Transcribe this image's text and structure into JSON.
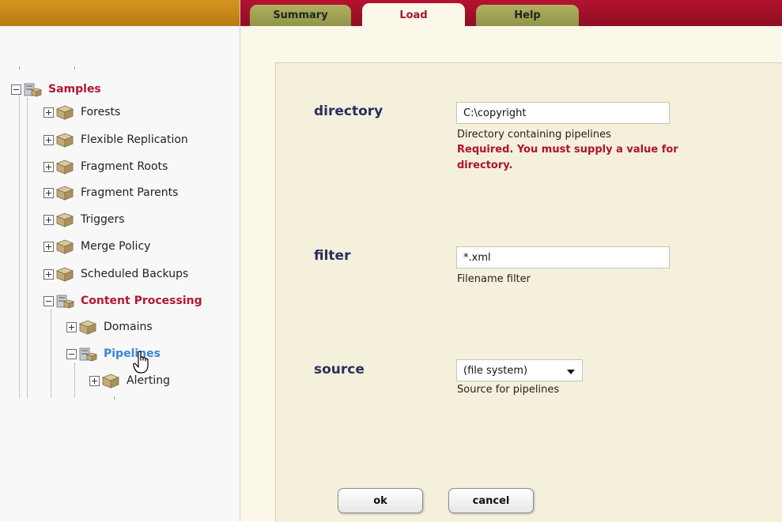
{
  "tabs": [
    "Summary",
    "Load",
    "Help"
  ],
  "tree": {
    "root": "Samples",
    "children": [
      "Forests",
      "Flexible Replication",
      "Fragment Roots",
      "Fragment Parents",
      "Triggers",
      "Merge Policy",
      "Scheduled Backups",
      "Content Processing"
    ],
    "content_processing_children": [
      "Domains",
      "Pipelines"
    ],
    "pipelines_children": [
      "Alerting"
    ]
  },
  "form": {
    "directory": {
      "label": "directory",
      "value": "C:\\copyright",
      "help": "Directory containing pipelines",
      "error": "Required. You must supply a value for directory."
    },
    "filter": {
      "label": "filter",
      "value": "*.xml",
      "help": "Filename filter"
    },
    "source": {
      "label": "source",
      "selected": "(file system)",
      "help": "Source for pipelines"
    },
    "buttons": {
      "ok": "ok",
      "cancel": "cancel"
    }
  },
  "colors": {
    "tree_open": "#b21734",
    "tree_selected": "#3b86d6",
    "label": "#27305f",
    "error": "#b0122c"
  }
}
